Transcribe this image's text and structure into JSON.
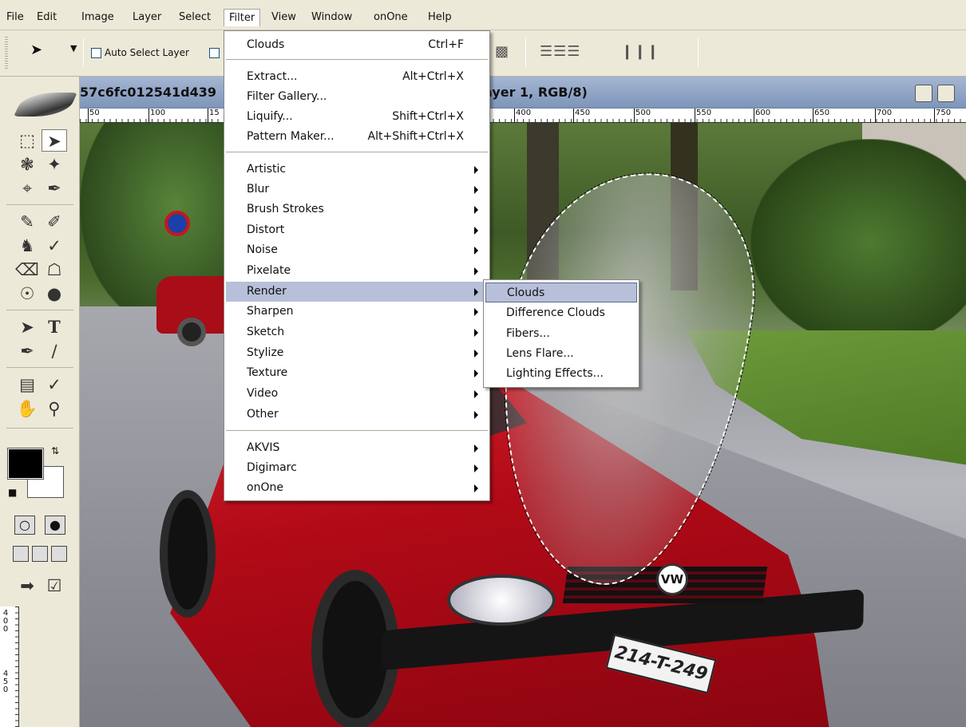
{
  "menubar": {
    "items": [
      "File",
      "Edit",
      "Image",
      "Layer",
      "Select",
      "Filter",
      "View",
      "Window",
      "onOne",
      "Help"
    ]
  },
  "options": {
    "auto_select_label": "Auto Select Layer"
  },
  "document": {
    "title_left": "57c6fc012541d439",
    "title_right": "ayer 1, RGB/8)"
  },
  "ruler": {
    "h_labels": [
      "50",
      "100",
      "15",
      "400",
      "450",
      "500",
      "550",
      "600",
      "650",
      "700",
      "750"
    ],
    "v_labels": [
      "4",
      "0",
      "0",
      "4",
      "5",
      "0"
    ]
  },
  "photo": {
    "plate_text": "214-T-249",
    "badge_text": "VW"
  },
  "filter_menu": {
    "groups": [
      [
        {
          "label": "Clouds",
          "shortcut": "Ctrl+F"
        }
      ],
      [
        {
          "label": "Extract...",
          "shortcut": "Alt+Ctrl+X"
        },
        {
          "label": "Filter Gallery...",
          "shortcut": ""
        },
        {
          "label": "Liquify...",
          "shortcut": "Shift+Ctrl+X"
        },
        {
          "label": "Pattern Maker...",
          "shortcut": "Alt+Shift+Ctrl+X"
        }
      ],
      [
        {
          "label": "Artistic",
          "submenu": true
        },
        {
          "label": "Blur",
          "submenu": true
        },
        {
          "label": "Brush Strokes",
          "submenu": true
        },
        {
          "label": "Distort",
          "submenu": true
        },
        {
          "label": "Noise",
          "submenu": true
        },
        {
          "label": "Pixelate",
          "submenu": true
        },
        {
          "label": "Render",
          "submenu": true,
          "highlighted": true
        },
        {
          "label": "Sharpen",
          "submenu": true
        },
        {
          "label": "Sketch",
          "submenu": true
        },
        {
          "label": "Stylize",
          "submenu": true
        },
        {
          "label": "Texture",
          "submenu": true
        },
        {
          "label": "Video",
          "submenu": true
        },
        {
          "label": "Other",
          "submenu": true
        }
      ],
      [
        {
          "label": "AKVIS",
          "submenu": true
        },
        {
          "label": "Digimarc",
          "submenu": true
        },
        {
          "label": "onOne",
          "submenu": true
        }
      ]
    ]
  },
  "render_submenu": {
    "items": [
      "Clouds",
      "Difference Clouds",
      "Fibers...",
      "Lens Flare...",
      "Lighting Effects..."
    ],
    "highlighted_index": 0
  },
  "colors": {
    "highlight": "#b7bfd9",
    "foreground": "#000000",
    "background": "#ffffff"
  }
}
